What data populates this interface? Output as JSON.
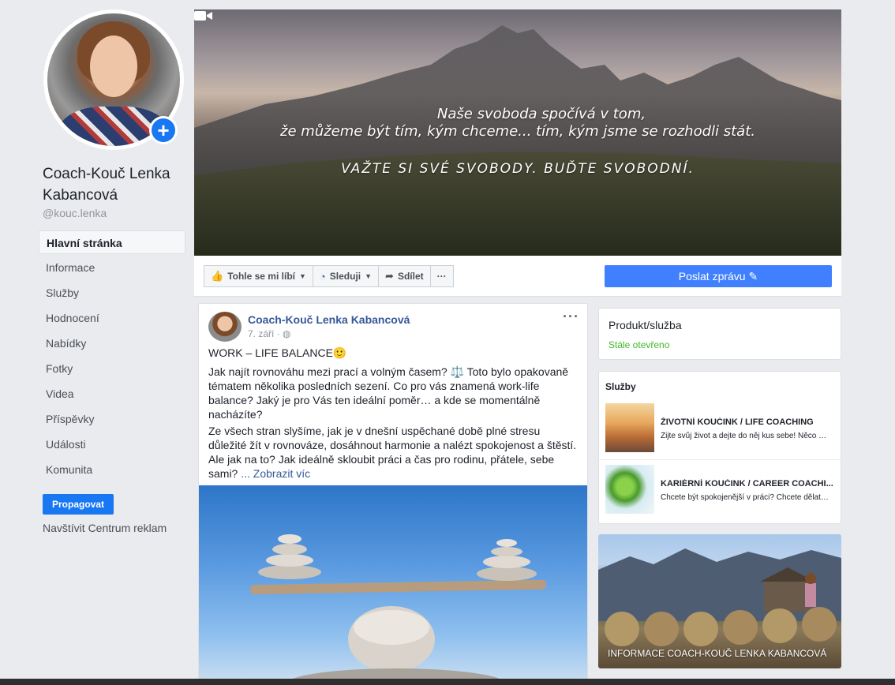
{
  "profile": {
    "name": "Coach-Kouč Lenka Kabancová",
    "handle": "@kouc.lenka"
  },
  "nav": {
    "items": [
      "Hlavní stránka",
      "Informace",
      "Služby",
      "Hodnocení",
      "Nabídky",
      "Fotky",
      "Videa",
      "Příspěvky",
      "Události",
      "Komunita"
    ],
    "active": "Hlavní stránka"
  },
  "promote": {
    "button_label": "Propagovat",
    "ads_link": "Navštívit Centrum reklam"
  },
  "cover": {
    "line1": "Naše svoboda spočívá v tom,",
    "line2": "že můžeme být tím, kým chceme... tím, kým jsme se rozhodli stát.",
    "line3": "VAŽTE SI SVÉ SVOBODY. BUĎTE SVOBODNÍ."
  },
  "actions": {
    "like": "Tohle se mi líbí",
    "follow": "Sleduji",
    "share": "Sdílet",
    "more": "···",
    "send_message": "Poslat zprávu ✎"
  },
  "post": {
    "author": "Coach-Kouč Lenka Kabancová",
    "date": "7. září · ",
    "title": "WORK – LIFE BALANCE🙂",
    "paragraph1": "Jak najít rovnováhu mezi prací a volným časem? ⚖️ Toto bylo opakovaně tématem několika posledních sezení. Co pro vás znamená work-life balance? Jaký je pro Vás ten ideální poměr… a kde se momentálně nacházíte?",
    "paragraph2": "Ze všech stran slyšíme, jak je v dnešní uspěchané době plné stresu důležité žít v rovnováze, dosáhnout harmonie a nalézt spokojenost a štěstí. Ale jak na to? Jak ideálně skloubit práci a čas pro rodinu, přátele, sebe sami?",
    "see_more": "... Zobrazit víc",
    "more": "···"
  },
  "info_card": {
    "category": "Produkt/služba",
    "status": "Stále otevřeno"
  },
  "services": {
    "heading": "Služby",
    "items": [
      {
        "title": "ŽIVOTNÍ KOUČINK / LIFE COACHING",
        "desc": "Žijte svůj život a dejte do něj kus sebe! Něco nefu..."
      },
      {
        "title": "KARIÉRNÍ KOUČINK / CAREER COACHI...",
        "desc": "Chcete být spokojenější v práci? Chcete dělat něc..."
      }
    ]
  },
  "about_card": {
    "title": "INFORMACE COACH-KOUČ LENKA KABANCOVÁ"
  },
  "colors": {
    "accent": "#4080ff",
    "link": "#365899",
    "status_open": "#42b72a",
    "background": "#e9ebee"
  }
}
